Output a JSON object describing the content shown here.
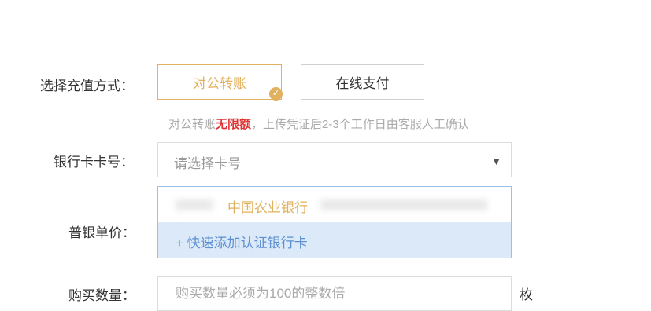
{
  "form": {
    "payment_method": {
      "label": "选择充值方式：",
      "options": [
        {
          "label": "对公转账",
          "selected": true
        },
        {
          "label": "在线支付",
          "selected": false
        }
      ],
      "hint": {
        "prefix": "对公转账",
        "highlight": "无限额",
        "suffix": "，上传凭证后2-3个工作日由客服人工确认"
      }
    },
    "bank_card": {
      "label": "银行卡卡号：",
      "placeholder": "请选择卡号",
      "dropdown": {
        "bank_name": "中国农业银行",
        "add_label": "+ 快速添加认证银行卡"
      }
    },
    "unit_price": {
      "label": "普银单价："
    },
    "quantity": {
      "label": "购买数量：",
      "placeholder": "购买数量必须为100的整数倍",
      "unit": "枚"
    }
  },
  "colors": {
    "accent_gold": "#e1b15f",
    "highlight_red": "#dd3333",
    "dropdown_highlight_bg": "#dce9f8",
    "link_blue": "#5b8fd1"
  },
  "icons": {
    "selected_check": "check-circle-icon",
    "select_caret": "caret-down-icon"
  }
}
